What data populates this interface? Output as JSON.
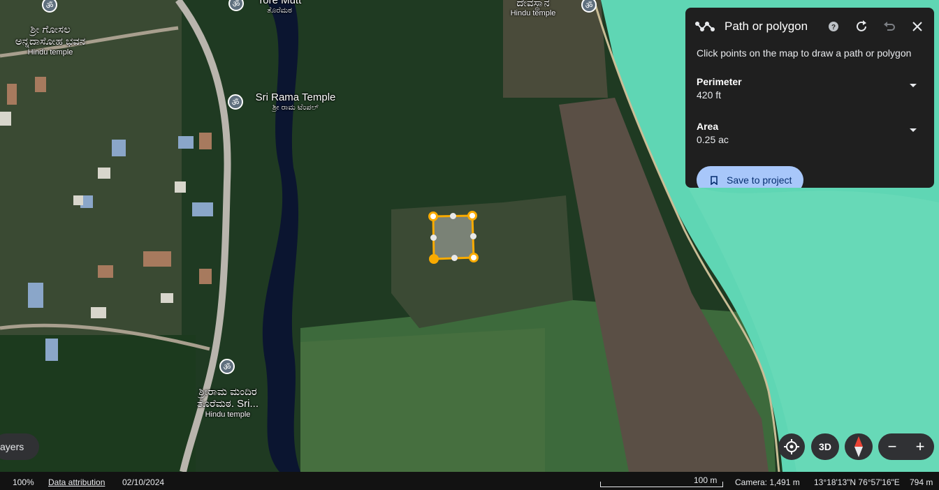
{
  "map": {
    "places": [
      {
        "id": "gosala",
        "line1": "ಶ್ರೀ ಗೋಸಲ",
        "line2": "ಅನ್ನದಾಸೋಹ ಭವನ",
        "line3": "Hindu temple"
      },
      {
        "id": "mutt",
        "line1": "Tore Mutt",
        "line2": "ತೊರೆಮಠ"
      },
      {
        "id": "devasthana",
        "line1": "ದೇವಸ್ಥಾನ",
        "line2": "Hindu temple"
      },
      {
        "id": "sri-rama",
        "line1": "Sri Rama Temple",
        "line2": "ಶ್ರೀ ರಾಮ ಟೆಂಪಲ್"
      },
      {
        "id": "ramamandira",
        "line1": "ಶ್ರೀರಾಮ ಮಂದಿರ",
        "line2": "ತೊರೆಮಠ. Sri...",
        "line3": "Hindu temple"
      }
    ],
    "pin_glyph": "ॐ"
  },
  "panel": {
    "title": "Path or polygon",
    "subtitle": "Click points on the map to draw a path or polygon",
    "perimeter_label": "Perimeter",
    "perimeter_value": "420 ft",
    "area_label": "Area",
    "area_value": "0.25 ac",
    "save_label": "Save to project",
    "icons": [
      "polygon-icon",
      "help-icon",
      "refresh-icon",
      "undo-icon",
      "close-icon"
    ]
  },
  "controls": {
    "layers_label": "ayers",
    "three_d_label": "3D",
    "zoom_out": "−",
    "zoom_in": "+"
  },
  "status_bar": {
    "zoom": "100%",
    "attribution": "Data attribution",
    "date": "02/10/2024",
    "scale": "100 m",
    "camera": "Camera: 1,491 m",
    "coords": "13°18'13\"N 76°57'16\"E",
    "elevation": "794 m"
  },
  "colors": {
    "polygon_stroke": "#f9ab00",
    "panel_bg": "#1f1f1f",
    "save_button": "#a8c7fa",
    "water": "#5fd6b4"
  }
}
